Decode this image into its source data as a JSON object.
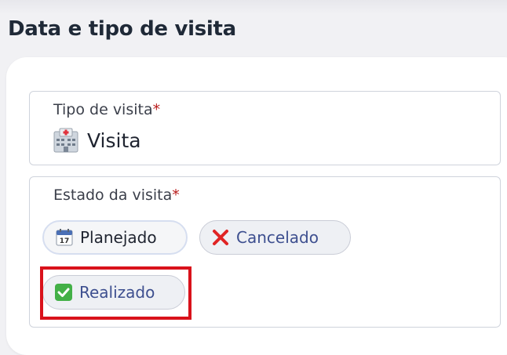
{
  "section": {
    "title": "Data e tipo de visita"
  },
  "visit_type": {
    "label": "Tipo de visita",
    "required_mark": "*",
    "value": "Visita",
    "icon": "hospital-icon"
  },
  "visit_status": {
    "label": "Estado da visita",
    "required_mark": "*",
    "options": [
      {
        "label": "Planejado",
        "icon": "calendar-icon",
        "selected": true
      },
      {
        "label": "Cancelado",
        "icon": "red-x-icon",
        "selected": false
      },
      {
        "label": "Realizado",
        "icon": "green-check-icon",
        "selected": false
      }
    ]
  },
  "annotation": {
    "highlight_color": "#d9121b",
    "highlighted_option": "Realizado"
  }
}
